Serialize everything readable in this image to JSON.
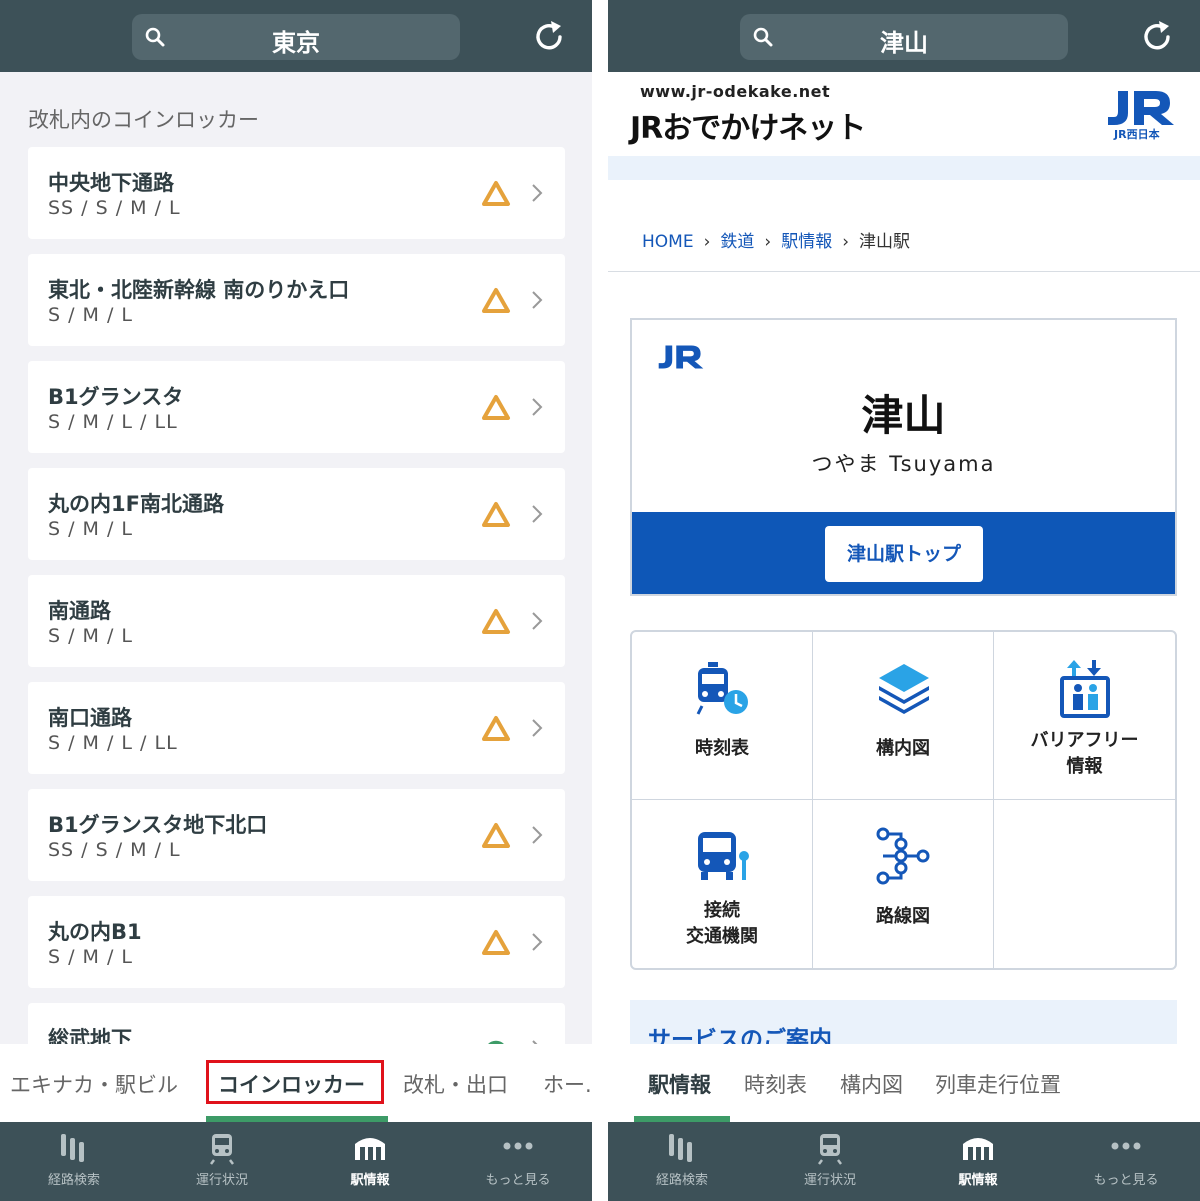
{
  "colors": {
    "bar": "#3d5158",
    "accent": "#3d9b67",
    "warn": "#e5a23c",
    "highlight": "#e0121b",
    "jr_blue": "#1457b8"
  },
  "left": {
    "search": {
      "value": "東京",
      "icon": "search-icon"
    },
    "section_title": "改札内のコインロッカー",
    "lockers": [
      {
        "name": "中央地下通路",
        "sizes": "SS / S / M / L",
        "status": "triangle"
      },
      {
        "name": "東北・北陸新幹線 南のりかえ口",
        "sizes": "S / M / L",
        "status": "triangle"
      },
      {
        "name": "B1グランスタ",
        "sizes": "S / M / L / LL",
        "status": "triangle"
      },
      {
        "name": "丸の内1F南北通路",
        "sizes": "S / M / L",
        "status": "triangle"
      },
      {
        "name": "南通路",
        "sizes": "S / M / L",
        "status": "triangle"
      },
      {
        "name": "南口通路",
        "sizes": "S / M / L / LL",
        "status": "triangle"
      },
      {
        "name": "B1グランスタ地下北口",
        "sizes": "SS / S / M / L",
        "status": "triangle"
      },
      {
        "name": "丸の内B1",
        "sizes": "S / M / L",
        "status": "triangle"
      },
      {
        "name": "総武地下",
        "sizes": "",
        "status": "circle"
      }
    ],
    "subtabs": [
      "エキナカ・駅ビル",
      "コインロッカー",
      "改札・出口",
      "ホー..."
    ],
    "nav": [
      "経路検索",
      "運行状況",
      "駅情報",
      "もっと見る"
    ]
  },
  "right": {
    "search": {
      "value": "津山",
      "icon": "search-icon"
    },
    "site_url": "www.jr-odekake.net",
    "site_name": "JRおでかけネット",
    "company": "JR西日本",
    "breadcrumb": [
      "HOME",
      "鉄道",
      "駅情報",
      "津山駅"
    ],
    "station": {
      "name": "津山",
      "kana": "つやま Tsuyama",
      "top_button": "津山駅トップ"
    },
    "menu": [
      {
        "label": "時刻表",
        "icon": "train-clock-icon",
        "external": true
      },
      {
        "label": "構内図",
        "icon": "layers-icon"
      },
      {
        "label": "バリアフリー\n情報",
        "icon": "elevator-icon"
      },
      {
        "label": "接続\n交通機関",
        "icon": "bus-icon"
      },
      {
        "label": "路線図",
        "icon": "route-map-icon"
      }
    ],
    "service_title": "サービスのご案内",
    "subtabs": [
      "駅情報",
      "時刻表",
      "構内図",
      "列車走行位置"
    ],
    "nav": [
      "経路検索",
      "運行状況",
      "駅情報",
      "もっと見る"
    ]
  }
}
